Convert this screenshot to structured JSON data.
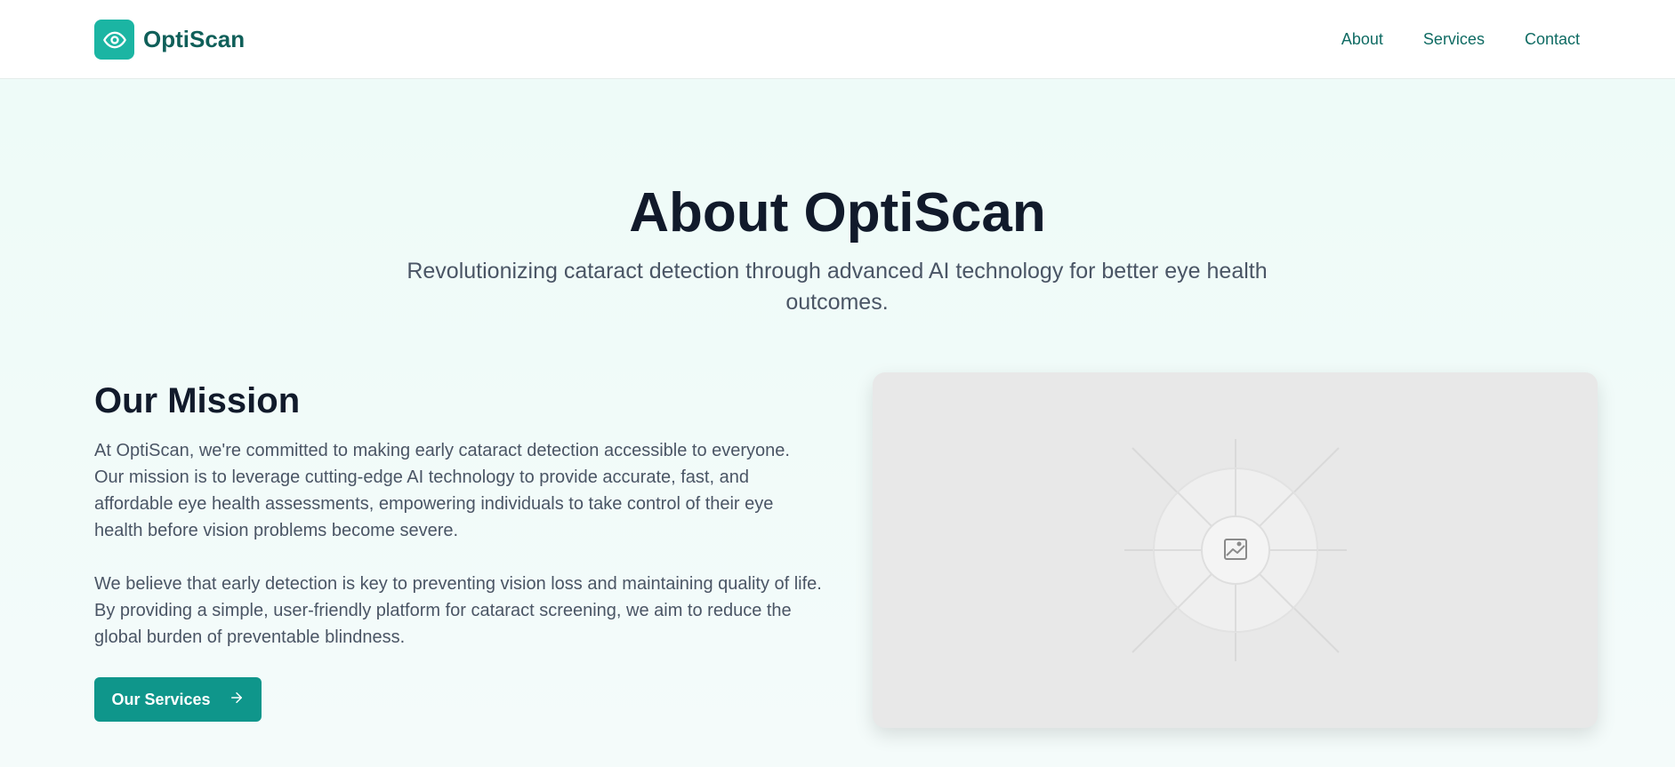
{
  "header": {
    "brand": "OptiScan",
    "logo_icon": "eye-icon",
    "nav": [
      {
        "label": "About"
      },
      {
        "label": "Services"
      },
      {
        "label": "Contact"
      }
    ]
  },
  "hero": {
    "title": "About OptiScan",
    "subtitle": "Revolutionizing cataract detection through advanced AI technology for better eye health outcomes."
  },
  "mission": {
    "title": "Our Mission",
    "paragraphs": [
      "At OptiScan, we're committed to making early cataract detection accessible to everyone. Our mission is to leverage cutting-edge AI technology to provide accurate, fast, and affordable eye health assessments, empowering individuals to take control of their eye health before vision problems become severe.",
      "We believe that early detection is key to preventing vision loss and maintaining quality of life. By providing a simple, user-friendly platform for cataract screening, we aim to reduce the global burden of preventable blindness."
    ],
    "button_label": "Our Services",
    "button_icon": "arrow-right-icon"
  },
  "image_placeholder": {
    "icon": "image-icon"
  },
  "colors": {
    "brand": "#1bb5a3",
    "button": "#0f968b",
    "heading": "#111a2b",
    "nav_text": "#0f6b63"
  }
}
